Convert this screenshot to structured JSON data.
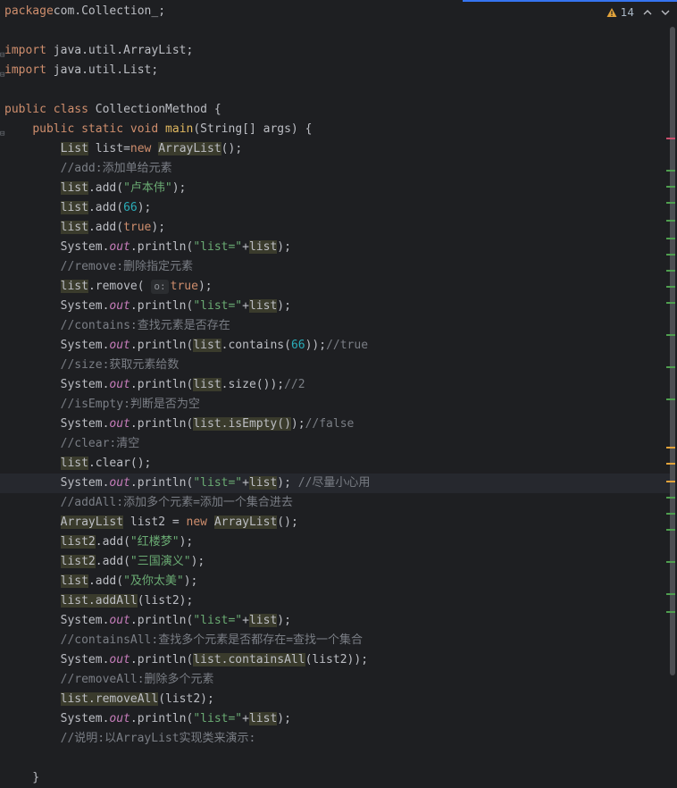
{
  "inspection": {
    "warning_count": "14",
    "warning_color": "#e2a33b",
    "icons": [
      "warning-icon",
      "chevron-up-icon",
      "chevron-down-icon"
    ]
  },
  "code": {
    "lines": [
      {
        "tokens": [
          [
            "kw",
            "package"
          ],
          [
            "",
            "com.Collection_;"
          ]
        ]
      },
      {
        "tokens": []
      },
      {
        "tokens": [
          [
            "kw",
            "import"
          ],
          [
            "",
            " java.util.ArrayList;"
          ]
        ],
        "fold": true
      },
      {
        "tokens": [
          [
            "kw",
            "import"
          ],
          [
            "",
            " java.util.List;"
          ]
        ],
        "fold": true
      },
      {
        "tokens": []
      },
      {
        "tokens": [
          [
            "kw",
            "public"
          ],
          [
            "",
            " "
          ],
          [
            "kw",
            "class"
          ],
          [
            "",
            " CollectionMethod {"
          ]
        ]
      },
      {
        "tokens": [
          [
            "",
            "    "
          ],
          [
            "kw",
            "public"
          ],
          [
            "",
            " "
          ],
          [
            "kw",
            "static"
          ],
          [
            "",
            " "
          ],
          [
            "kw",
            "void"
          ],
          [
            "",
            " "
          ],
          [
            "fn-main",
            "main"
          ],
          [
            "",
            "(String[] args) {"
          ]
        ],
        "fold": true
      },
      {
        "tokens": [
          [
            "",
            "        "
          ],
          [
            "hl",
            "List"
          ],
          [
            "",
            " list="
          ],
          [
            "kw",
            "new"
          ],
          [
            "",
            " "
          ],
          [
            "hl",
            "ArrayList"
          ],
          [
            "",
            "();"
          ]
        ]
      },
      {
        "tokens": [
          [
            "",
            "        "
          ],
          [
            "cmt",
            "//add:添加单给元素"
          ]
        ]
      },
      {
        "tokens": [
          [
            "",
            "        "
          ],
          [
            "hl",
            "list"
          ],
          [
            "",
            ".add("
          ],
          [
            "str",
            "\"卢本伟\""
          ],
          [
            "",
            ");"
          ]
        ]
      },
      {
        "tokens": [
          [
            "",
            "        "
          ],
          [
            "hl",
            "list"
          ],
          [
            "",
            ".add("
          ],
          [
            "num",
            "66"
          ],
          [
            "",
            ");"
          ]
        ]
      },
      {
        "tokens": [
          [
            "",
            "        "
          ],
          [
            "hl",
            "list"
          ],
          [
            "",
            ".add("
          ],
          [
            "kw",
            "true"
          ],
          [
            "",
            ");"
          ]
        ]
      },
      {
        "tokens": [
          [
            "",
            "        System."
          ],
          [
            "fld",
            "out"
          ],
          [
            "",
            ".println("
          ],
          [
            "str",
            "\"list=\""
          ],
          [
            "",
            "+"
          ],
          [
            "hl",
            "list"
          ],
          [
            "",
            ");"
          ]
        ]
      },
      {
        "tokens": [
          [
            "",
            "        "
          ],
          [
            "cmt",
            "//remove:删除指定元素"
          ]
        ]
      },
      {
        "tokens": [
          [
            "",
            "        "
          ],
          [
            "hl",
            "list"
          ],
          [
            "",
            ".remove( "
          ],
          [
            "hint",
            "o:"
          ],
          [
            "kw",
            "true"
          ],
          [
            "",
            ");"
          ]
        ]
      },
      {
        "tokens": [
          [
            "",
            "        System."
          ],
          [
            "fld",
            "out"
          ],
          [
            "",
            ".println("
          ],
          [
            "str",
            "\"list=\""
          ],
          [
            "",
            "+"
          ],
          [
            "hl",
            "list"
          ],
          [
            "",
            ");"
          ]
        ]
      },
      {
        "tokens": [
          [
            "",
            "        "
          ],
          [
            "cmt",
            "//contains:查找元素是否存在"
          ]
        ]
      },
      {
        "tokens": [
          [
            "",
            "        System."
          ],
          [
            "fld",
            "out"
          ],
          [
            "",
            ".println("
          ],
          [
            "hl",
            "list"
          ],
          [
            "",
            ".contains("
          ],
          [
            "num",
            "66"
          ],
          [
            "",
            "));"
          ],
          [
            "cmt",
            "//true"
          ]
        ]
      },
      {
        "tokens": [
          [
            "",
            "        "
          ],
          [
            "cmt",
            "//size:获取元素给数"
          ]
        ]
      },
      {
        "tokens": [
          [
            "",
            "        System."
          ],
          [
            "fld",
            "out"
          ],
          [
            "",
            ".println("
          ],
          [
            "hl",
            "list"
          ],
          [
            "",
            ".size());"
          ],
          [
            "cmt",
            "//2"
          ]
        ]
      },
      {
        "tokens": [
          [
            "",
            "        "
          ],
          [
            "cmt",
            "//isEmpty:判断是否为空"
          ]
        ]
      },
      {
        "tokens": [
          [
            "",
            "        System."
          ],
          [
            "fld",
            "out"
          ],
          [
            "",
            ".println("
          ],
          [
            "hl",
            "list.isEmpty()"
          ],
          [
            "",
            ");"
          ],
          [
            "cmt",
            "//false"
          ]
        ]
      },
      {
        "tokens": [
          [
            "",
            "        "
          ],
          [
            "cmt",
            "//clear:清空"
          ]
        ]
      },
      {
        "tokens": [
          [
            "",
            "        "
          ],
          [
            "hl",
            "list"
          ],
          [
            "",
            ".clear();"
          ]
        ]
      },
      {
        "tokens": [
          [
            "",
            "        System."
          ],
          [
            "fld",
            "out"
          ],
          [
            "",
            ".println("
          ],
          [
            "str",
            "\"list=\""
          ],
          [
            "",
            "+"
          ],
          [
            "hl",
            "list"
          ],
          [
            "",
            "); "
          ],
          [
            "cmt",
            "//尽量小心用"
          ]
        ],
        "current": true
      },
      {
        "tokens": [
          [
            "",
            "        "
          ],
          [
            "cmt",
            "//addAll:添加多个元素=添加一个集合进去"
          ]
        ]
      },
      {
        "tokens": [
          [
            "",
            "        "
          ],
          [
            "hl",
            "ArrayList"
          ],
          [
            "",
            " list2 = "
          ],
          [
            "kw",
            "new"
          ],
          [
            "",
            " "
          ],
          [
            "hl",
            "ArrayList"
          ],
          [
            "",
            "();"
          ]
        ]
      },
      {
        "tokens": [
          [
            "",
            "        "
          ],
          [
            "hl",
            "list2"
          ],
          [
            "",
            ".add("
          ],
          [
            "str",
            "\"红楼梦\""
          ],
          [
            "",
            ");"
          ]
        ]
      },
      {
        "tokens": [
          [
            "",
            "        "
          ],
          [
            "hl",
            "list2"
          ],
          [
            "",
            ".add("
          ],
          [
            "str",
            "\"三国演义\""
          ],
          [
            "",
            ");"
          ]
        ]
      },
      {
        "tokens": [
          [
            "",
            "        "
          ],
          [
            "hl",
            "list"
          ],
          [
            "",
            ".add("
          ],
          [
            "str",
            "\"及你太美\""
          ],
          [
            "",
            ");"
          ]
        ]
      },
      {
        "tokens": [
          [
            "",
            "        "
          ],
          [
            "hl",
            "list.addAll"
          ],
          [
            "",
            "(list2);"
          ]
        ]
      },
      {
        "tokens": [
          [
            "",
            "        System."
          ],
          [
            "fld",
            "out"
          ],
          [
            "",
            ".println("
          ],
          [
            "str",
            "\"list=\""
          ],
          [
            "",
            "+"
          ],
          [
            "hl",
            "list"
          ],
          [
            "",
            ");"
          ]
        ]
      },
      {
        "tokens": [
          [
            "",
            "        "
          ],
          [
            "cmt",
            "//containsAll:查找多个元素是否都存在=查找一个集合"
          ]
        ]
      },
      {
        "tokens": [
          [
            "",
            "        System."
          ],
          [
            "fld",
            "out"
          ],
          [
            "",
            ".println("
          ],
          [
            "hl",
            "list.containsAll"
          ],
          [
            "",
            "(list2));"
          ]
        ]
      },
      {
        "tokens": [
          [
            "",
            "        "
          ],
          [
            "cmt",
            "//removeAll:删除多个元素"
          ]
        ]
      },
      {
        "tokens": [
          [
            "",
            "        "
          ],
          [
            "hl",
            "list.removeAll"
          ],
          [
            "",
            "(list2);"
          ]
        ]
      },
      {
        "tokens": [
          [
            "",
            "        System."
          ],
          [
            "fld",
            "out"
          ],
          [
            "",
            ".println("
          ],
          [
            "str",
            "\"list=\""
          ],
          [
            "",
            "+"
          ],
          [
            "hl",
            "list"
          ],
          [
            "",
            ");"
          ]
        ]
      },
      {
        "tokens": [
          [
            "",
            "        "
          ],
          [
            "cmt",
            "//说明:以ArrayList实现类来演示:"
          ]
        ]
      },
      {
        "tokens": []
      },
      {
        "tokens": [
          [
            "",
            "    }"
          ]
        ]
      }
    ]
  },
  "colors": {
    "background": "#1e1f22",
    "keyword": "#cf8e6d",
    "string": "#6aab73",
    "number": "#2aacb8",
    "comment": "#7a7e85",
    "field": "#c77dbb",
    "method_decl": "#e0b860",
    "accent": "#3574f0"
  }
}
